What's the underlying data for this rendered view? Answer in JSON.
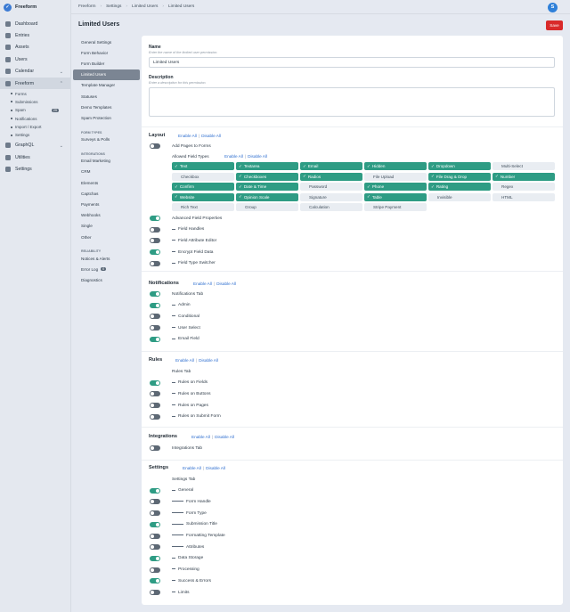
{
  "app": {
    "name": "Freeform",
    "avatar": "S"
  },
  "sidebar": {
    "items": [
      {
        "label": "Dashboard",
        "icon": "dashboard-icon"
      },
      {
        "label": "Entries",
        "icon": "entries-icon"
      },
      {
        "label": "Assets",
        "icon": "assets-icon"
      },
      {
        "label": "Users",
        "icon": "users-icon"
      },
      {
        "label": "Calendar",
        "icon": "calendar-icon"
      },
      {
        "label": "Freeform",
        "icon": "freeform-icon"
      },
      {
        "label": "GraphQL",
        "icon": "graphql-icon"
      },
      {
        "label": "Utilities",
        "icon": "utilities-icon"
      },
      {
        "label": "Settings",
        "icon": "settings-icon"
      }
    ],
    "sub": [
      "Forms",
      "Submissions",
      "Spam",
      "Notifications",
      "Import / Export",
      "Settings"
    ],
    "spam_count": "29"
  },
  "breadcrumb": [
    "Freeform",
    "Settings",
    "Limited Users",
    "Limited Users"
  ],
  "page": {
    "title": "Limited Users",
    "save": "Save"
  },
  "settings_nav": {
    "main": [
      "General Settings",
      "Form Behavior",
      "Form Builder",
      "Limited Users",
      "Template Manager",
      "Statuses",
      "Demo Templates",
      "Spam Protection"
    ],
    "form_types_head": "FORM TYPES",
    "form_types": [
      "Surveys & Polls"
    ],
    "integrations_head": "INTEGRATIONS",
    "integrations": [
      "Email Marketing",
      "CRM",
      "Elements",
      "Captchas",
      "Payments",
      "Webhooks",
      "Single",
      "Other"
    ],
    "reliability_head": "RELIABILITY",
    "reliability": [
      "Notices & Alerts",
      "Error Log",
      "Diagnostics"
    ],
    "error_count": "0"
  },
  "form": {
    "name_label": "Name",
    "name_hint": "Enter the name of the limited user permission.",
    "name_value": "Limited Users",
    "desc_label": "Description",
    "desc_hint": "Enter a description for this permission.",
    "desc_value": ""
  },
  "links": {
    "enable": "Enable All",
    "disable": "Disable All"
  },
  "layout": {
    "title": "Layout",
    "pages": "Add Pages to Forms",
    "aft": "Allowed Field Types",
    "types": [
      {
        "l": "Text",
        "on": true
      },
      {
        "l": "Textarea",
        "on": true
      },
      {
        "l": "Email",
        "on": true
      },
      {
        "l": "Hidden",
        "on": true
      },
      {
        "l": "Dropdown",
        "on": true
      },
      {
        "l": "Multi-Select",
        "on": false
      },
      {
        "l": "Checkbox",
        "on": false
      },
      {
        "l": "Checkboxes",
        "on": true
      },
      {
        "l": "Radios",
        "on": true
      },
      {
        "l": "File Upload",
        "on": false
      },
      {
        "l": "File Drag & Drop",
        "on": true
      },
      {
        "l": "Number",
        "on": true
      },
      {
        "l": "Confirm",
        "on": true
      },
      {
        "l": "Date & Time",
        "on": true
      },
      {
        "l": "Password",
        "on": false
      },
      {
        "l": "Phone",
        "on": true
      },
      {
        "l": "Rating",
        "on": true
      },
      {
        "l": "Regex",
        "on": false
      },
      {
        "l": "Website",
        "on": true
      },
      {
        "l": "Opinion Scale",
        "on": true
      },
      {
        "l": "Signature",
        "on": false
      },
      {
        "l": "Table",
        "on": true
      },
      {
        "l": "Invisible",
        "on": false
      },
      {
        "l": "HTML",
        "on": false
      },
      {
        "l": "Rich Text",
        "on": false
      },
      {
        "l": "Group",
        "on": false
      },
      {
        "l": "Calculation",
        "on": false
      },
      {
        "l": "Stripe Payment",
        "on": false
      }
    ],
    "rows": [
      {
        "l": "Advanced Field Properties",
        "on": true,
        "d": 0
      },
      {
        "l": "Field Handles",
        "on": false,
        "d": 1
      },
      {
        "l": "Field Attribute Editor",
        "on": false,
        "d": 1
      },
      {
        "l": "Encrypt Field Data",
        "on": true,
        "d": 1
      },
      {
        "l": "Field Type Switcher",
        "on": false,
        "d": 1
      }
    ]
  },
  "notifications": {
    "title": "Notifications",
    "rows": [
      {
        "l": "Notifications Tab",
        "on": true,
        "d": 0
      },
      {
        "l": "Admin",
        "on": true,
        "d": 1
      },
      {
        "l": "Conditional",
        "on": false,
        "d": 1
      },
      {
        "l": "User Select",
        "on": false,
        "d": 1
      },
      {
        "l": "Email Field",
        "on": true,
        "d": 1
      }
    ]
  },
  "rules": {
    "title": "Rules",
    "rows": [
      {
        "l": "Rules Tab",
        "on": null,
        "d": 0
      },
      {
        "l": "Rules on Fields",
        "on": true,
        "d": 1
      },
      {
        "l": "Rules on Buttons",
        "on": false,
        "d": 1
      },
      {
        "l": "Rules on Pages",
        "on": false,
        "d": 1
      },
      {
        "l": "Rules on Submit Form",
        "on": false,
        "d": 1
      }
    ]
  },
  "integrations": {
    "title": "Integrations",
    "rows": [
      {
        "l": "Integrations Tab",
        "on": false,
        "d": 0
      }
    ]
  },
  "settings": {
    "title": "Settings",
    "rows": [
      {
        "l": "Settings Tab",
        "on": null,
        "d": 0
      },
      {
        "l": "General",
        "on": true,
        "d": 1
      },
      {
        "l": "Form Handle",
        "on": false,
        "d": 2
      },
      {
        "l": "Form Type",
        "on": false,
        "d": 2
      },
      {
        "l": "Submission Title",
        "on": true,
        "d": 2
      },
      {
        "l": "Formatting Template",
        "on": false,
        "d": 2
      },
      {
        "l": "Attributes",
        "on": false,
        "d": 2
      },
      {
        "l": "Data Storage",
        "on": true,
        "d": 1
      },
      {
        "l": "Processing",
        "on": false,
        "d": 1
      },
      {
        "l": "Success & Errors",
        "on": true,
        "d": 1
      },
      {
        "l": "Limits",
        "on": false,
        "d": 1
      }
    ]
  }
}
